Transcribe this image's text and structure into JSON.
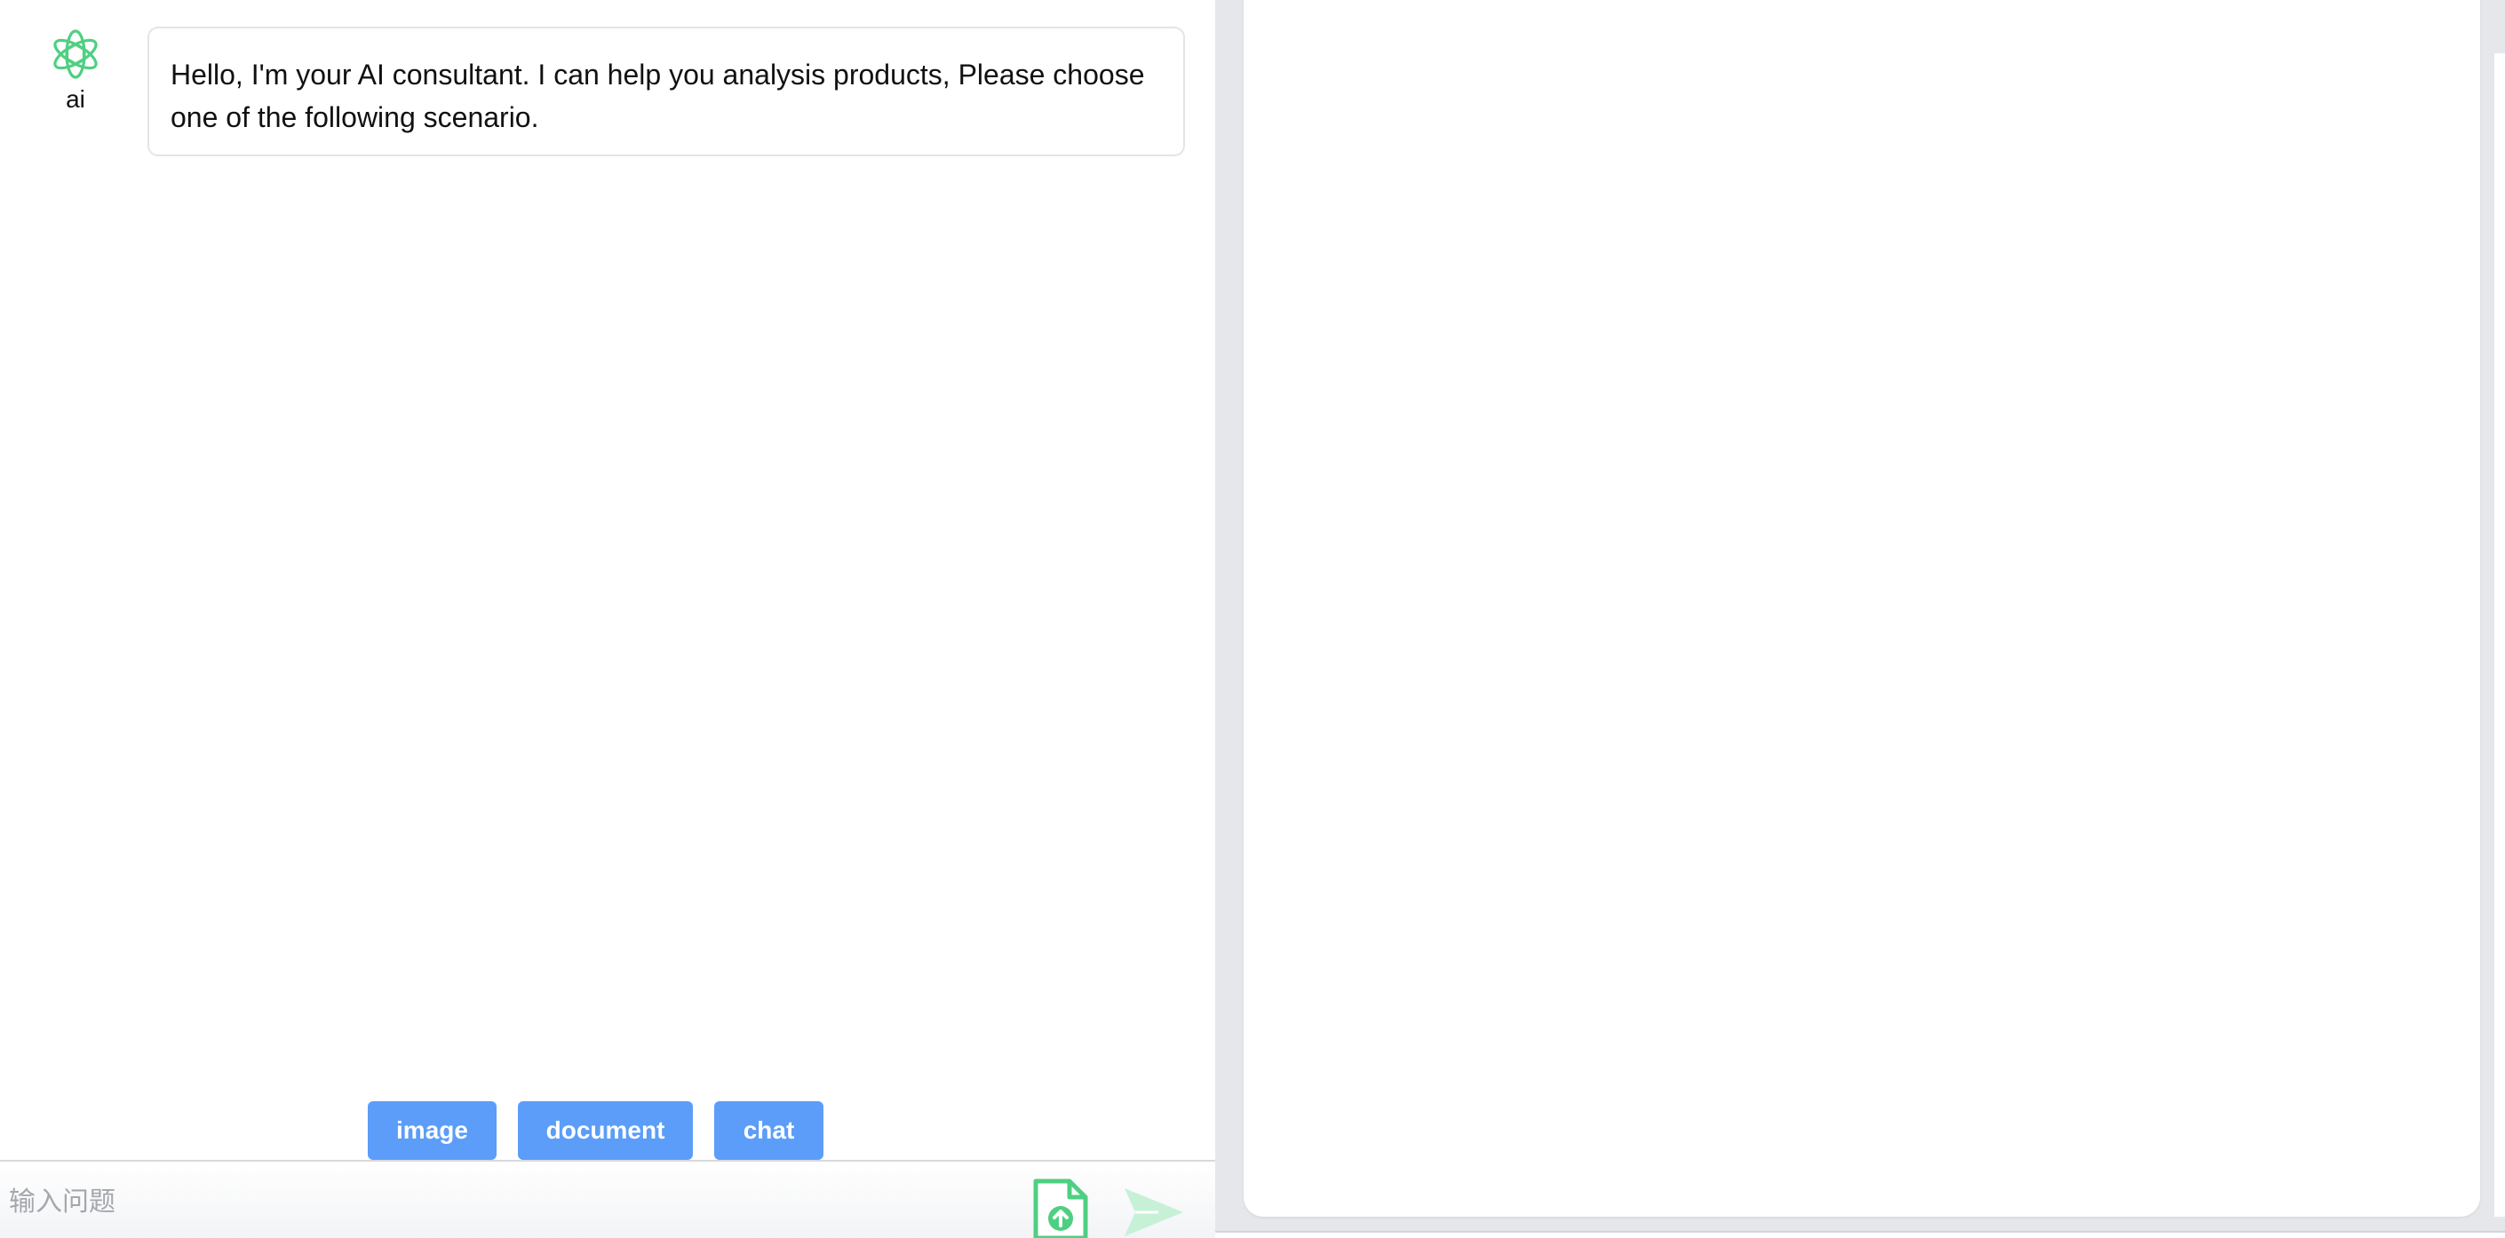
{
  "assistant": {
    "avatar_icon": "openai-logo-icon",
    "avatar_color": "#4fcf82",
    "label": "ai",
    "greeting": "Hello, I'm your AI consultant. I can help you analysis products, Please choose one of the following scenario."
  },
  "scenarios": {
    "image_label": "image",
    "document_label": "document",
    "chat_label": "chat",
    "button_color": "#5b9df9"
  },
  "input": {
    "placeholder": "输入问题",
    "value": ""
  },
  "icons": {
    "upload": "file-upload-icon",
    "send": "send-icon"
  }
}
